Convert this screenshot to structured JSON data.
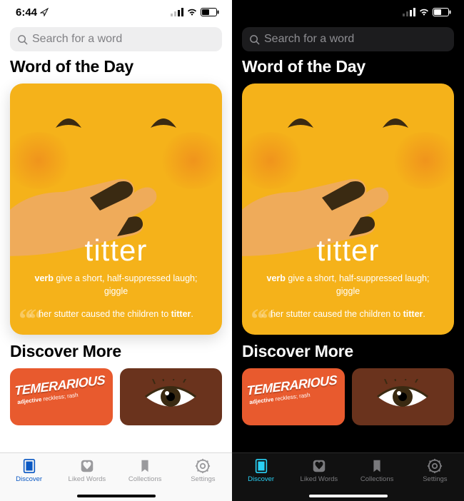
{
  "status": {
    "time": "6:44"
  },
  "search": {
    "placeholder": "Search for a word"
  },
  "sections": {
    "wotd_heading": "Word of the Day",
    "discover_heading": "Discover More"
  },
  "wotd": {
    "word": "titter",
    "pos": "verb",
    "definition": "give a short, half-suppressed laugh; giggle",
    "example_pre": "her stutter caused the children to ",
    "example_word": "titter",
    "example_post": "."
  },
  "discover": {
    "card1": {
      "title": "TEMERARIOUS",
      "pos": "adjective",
      "def": "reckless; rash"
    }
  },
  "tabs": {
    "discover": "Discover",
    "liked": "Liked Words",
    "collections": "Collections",
    "settings": "Settings"
  },
  "colors": {
    "card_bg": "#f5b21a",
    "accent_light": "#0a58c3",
    "accent_dark": "#2ad1f5"
  }
}
